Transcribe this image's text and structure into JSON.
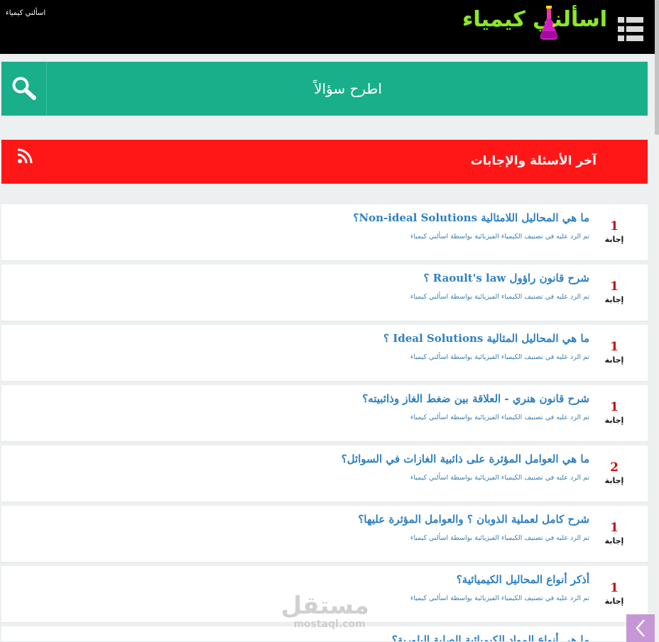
{
  "header": {
    "site_name_small": "اسألني كيمياء",
    "logo_text": "اسألني كيمياء",
    "menu_icon": "hamburger-icon"
  },
  "ask": {
    "label": "اطرح سؤالاً",
    "icon": "search-icon"
  },
  "section": {
    "title": "آخر الأسئلة والإجابات",
    "icon": "rss-icon"
  },
  "answer_label": "إجابة",
  "questions": [
    {
      "title": "ما هي المحاليل اللامثالية Non-ideal Solutions؟",
      "answers": "1",
      "meta": "تم الرد عليه في تصنيف الكيمياء الفيزيائية بواسطة اسألني كيمياء"
    },
    {
      "title": "شرح قانون راؤول Raoult's law ؟",
      "answers": "1",
      "meta": "تم الرد عليه في تصنيف الكيمياء الفيزيائية بواسطة اسألني كيمياء"
    },
    {
      "title": "ما هي المحاليل المثالية Ideal Solutions ؟",
      "answers": "1",
      "meta": "تم الرد عليه في تصنيف الكيمياء الفيزيائية بواسطة اسألني كيمياء"
    },
    {
      "title": "شرح قانون هنري - العلاقة بين ضغط الغاز وذائبيته؟",
      "answers": "1",
      "meta": "تم الرد عليه في تصنيف الكيمياء الفيزيائية بواسطة اسألني كيمياء"
    },
    {
      "title": "ما هي العوامل المؤثرة على ذائبية الغازات في السوائل؟",
      "answers": "2",
      "meta": "تم الرد عليه في تصنيف الكيمياء الفيزيائية بواسطة اسألني كيمياء"
    },
    {
      "title": "شرح كامل لعملية الذوبان ؟ والعوامل المؤثرة عليها؟",
      "answers": "1",
      "meta": "تم الرد عليه في تصنيف الكيمياء الفيزيائية بواسطة اسألني كيمياء"
    },
    {
      "title": "أذكر أنواع المحاليل الكيميائية؟",
      "answers": "1",
      "meta": "تم الرد عليه في تصنيف الكيمياء الفيزيائية بواسطة اسألني كيمياء"
    },
    {
      "title": "ما هي أنواع المواد الكيميائية الصلبة البلورية؟",
      "answers": "",
      "meta": ""
    }
  ],
  "watermark": {
    "ar": "مستقل",
    "en": "mostaql.com"
  },
  "colors": {
    "header_bg": "#000000",
    "ask_bar": "#1aaf8b",
    "section_bar": "#ff1717",
    "question_link": "#2e80c2",
    "answer_count": "#c41111",
    "logo_green": "#8ce826",
    "back_button": "#c697d6"
  }
}
